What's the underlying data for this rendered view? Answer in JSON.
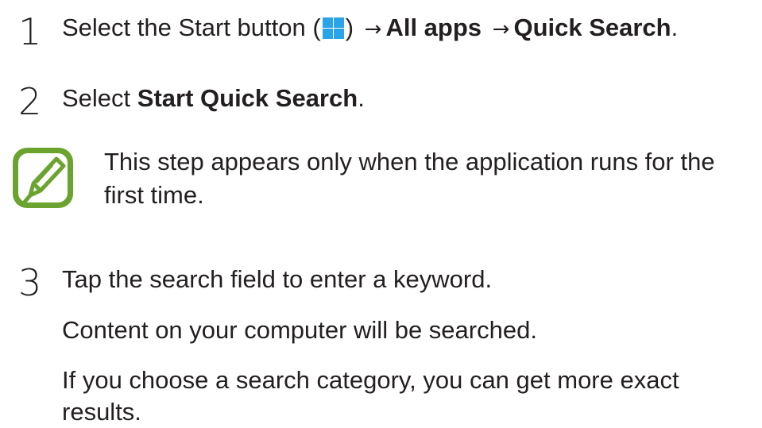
{
  "steps": [
    {
      "number": "1",
      "text_before": "Select the Start button (",
      "text_after": ")",
      "arrow1": "→",
      "bold1": "All apps",
      "arrow2": "→",
      "bold2": "Quick Search",
      "end": "."
    },
    {
      "number": "2",
      "text_before": "Select ",
      "bold1": "Start Quick Search",
      "end": "."
    },
    {
      "number": "3",
      "line1": "Tap the search field to enter a keyword.",
      "line2": "Content on your computer will be searched.",
      "line3": "If you choose a search category, you can get more exact",
      "line4": "results."
    }
  ],
  "note": {
    "icon": "note-pen-icon",
    "text": "This step appears only when the application runs for the first time."
  },
  "colors": {
    "text": "#231f20",
    "note_icon": "#6aa32e",
    "start_icon": "#2aa4e8"
  }
}
